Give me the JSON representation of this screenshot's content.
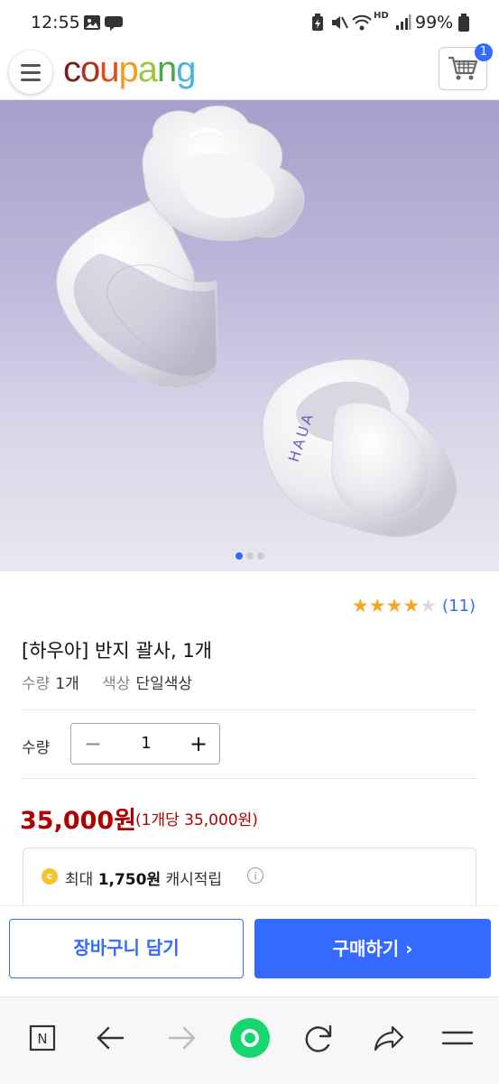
{
  "status_bar": {
    "time": "12:55",
    "battery": "99%",
    "network_label": "HD"
  },
  "header": {
    "logo": {
      "c": "c",
      "o1": "o",
      "u": "u",
      "p": "p",
      "a": "a",
      "n": "n",
      "g": "g"
    },
    "cart_count": "1"
  },
  "gallery": {
    "image_count": 3,
    "active_index": 0,
    "ring_engraving": "HAUA"
  },
  "product": {
    "rating": 4,
    "rating_max": 5,
    "review_count": "(11)",
    "title": "[하우아] 반지 괄사, 1개",
    "options": [
      {
        "key": "수량",
        "value": "1개"
      },
      {
        "key": "색상",
        "value": "단일색상"
      }
    ],
    "quantity_label": "수량",
    "quantity": "1",
    "minus": "−",
    "plus": "+",
    "price": "35,000원",
    "unit_price": "(1개당 35,000원)"
  },
  "cashback": {
    "prefix": "최대",
    "amount": "1,750원",
    "suffix": "캐시적립",
    "coin_letter": "c",
    "info": "i"
  },
  "buttons": {
    "add_to_cart": "장바구니 담기",
    "buy_now": "구매하기 ›"
  },
  "browser_nav": {
    "n_label": "N"
  },
  "colors": {
    "accent": "#346aff",
    "price": "#ae0000",
    "star": "#f5a623",
    "logo_c": "#7b1c1c",
    "logo_o": "#b23019",
    "logo_u": "#e14b1d",
    "logo_p": "#f19c22",
    "logo_a": "#9ec63c",
    "logo_n": "#4ba94a",
    "logo_g": "#4bb3e1"
  }
}
